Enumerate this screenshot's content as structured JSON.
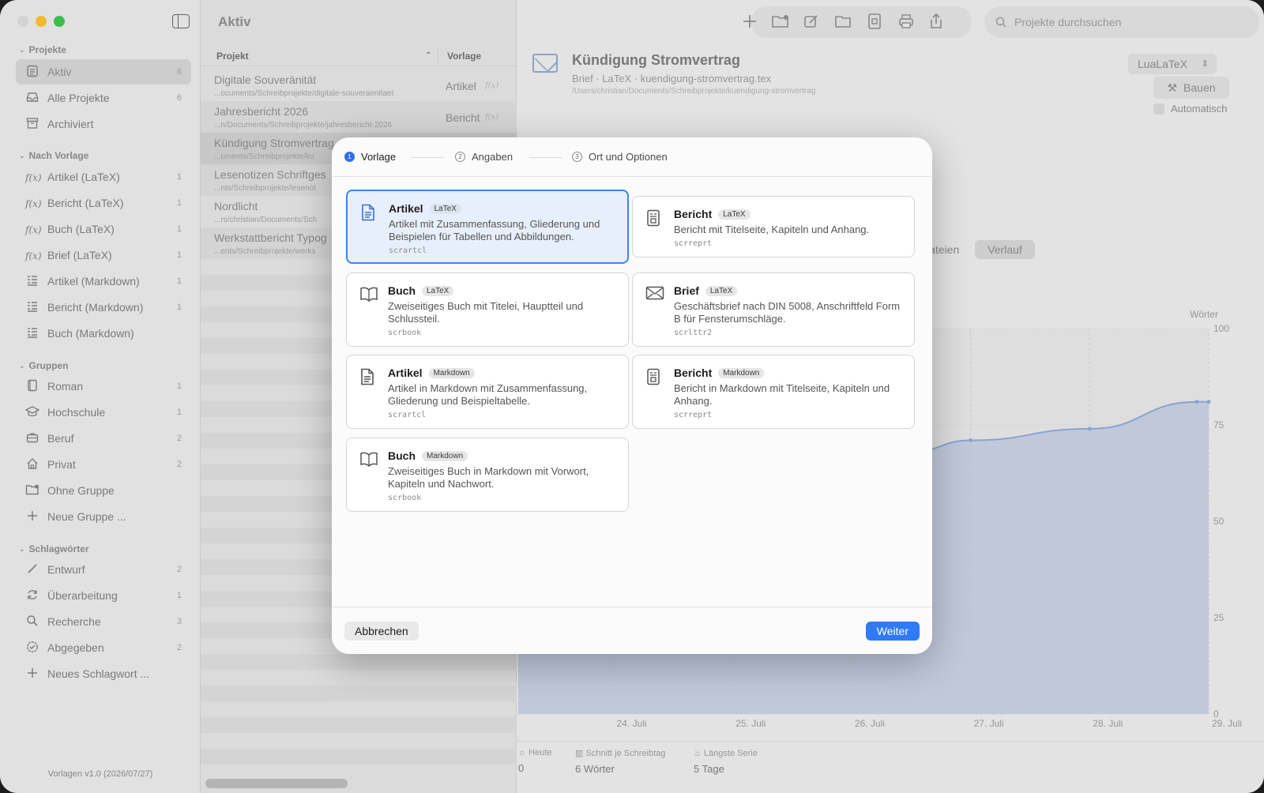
{
  "window": {
    "traffic_colors": [
      "#d8d8d8",
      "#f5be2f",
      "#3fc24e"
    ]
  },
  "sidebar": {
    "sections": [
      {
        "title": "Projekte",
        "items": [
          {
            "label": "Aktiv",
            "count": "6",
            "icon": "checklist-icon",
            "active": true
          },
          {
            "label": "Alle Projekte",
            "count": "6",
            "icon": "tray-icon"
          },
          {
            "label": "Archiviert",
            "count": "",
            "icon": "archive-box-icon"
          }
        ]
      },
      {
        "title": "Nach Vorlage",
        "items": [
          {
            "label": "Artikel (LaTeX)",
            "count": "1",
            "icon": "function-icon"
          },
          {
            "label": "Bericht (LaTeX)",
            "count": "1",
            "icon": "function-icon"
          },
          {
            "label": "Buch (LaTeX)",
            "count": "1",
            "icon": "function-icon"
          },
          {
            "label": "Brief (LaTeX)",
            "count": "1",
            "icon": "function-icon"
          },
          {
            "label": "Artikel (Markdown)",
            "count": "1",
            "icon": "markdown-list-icon"
          },
          {
            "label": "Bericht (Markdown)",
            "count": "1",
            "icon": "markdown-list-icon"
          },
          {
            "label": "Buch (Markdown)",
            "count": "",
            "icon": "markdown-list-icon"
          }
        ]
      },
      {
        "title": "Gruppen",
        "items": [
          {
            "label": "Roman",
            "count": "1",
            "icon": "book-icon"
          },
          {
            "label": "Hochschule",
            "count": "1",
            "icon": "graduation-cap-icon"
          },
          {
            "label": "Beruf",
            "count": "2",
            "icon": "briefcase-icon"
          },
          {
            "label": "Privat",
            "count": "2",
            "icon": "house-icon"
          },
          {
            "label": "Ohne Gruppe",
            "count": "",
            "icon": "folder-badge-icon"
          },
          {
            "label": "Neue Gruppe ...",
            "count": "",
            "icon": "plus-icon"
          }
        ]
      },
      {
        "title": "Schlagwörter",
        "items": [
          {
            "label": "Entwurf",
            "count": "2",
            "icon": "pencil-icon"
          },
          {
            "label": "Überarbeitung",
            "count": "1",
            "icon": "refresh-icon"
          },
          {
            "label": "Recherche",
            "count": "3",
            "icon": "magnifier-icon"
          },
          {
            "label": "Abgegeben",
            "count": "2",
            "icon": "checkmark-seal-icon"
          },
          {
            "label": "Neues Schlagwort ...",
            "count": "",
            "icon": "plus-icon"
          }
        ]
      }
    ],
    "footer": "Vorlagen v1.0 (2026/07/27)"
  },
  "list": {
    "title": "Aktiv",
    "col_project": "Projekt",
    "col_template": "Vorlage",
    "rows": [
      {
        "title": "Digitale Souveränität",
        "path": "...ocuments/Schreibprojekte/digitale-souveraenitaet",
        "template": "Artikel",
        "fx": "f(x)"
      },
      {
        "title": "Jahresbericht 2026",
        "path": "...n/Documents/Schreibprojekte/jahresbericht-2026",
        "template": "Bericht",
        "fx": "f(x)"
      },
      {
        "title": "Kündigung Stromvertrag",
        "path": "...uments/Schreibprojekte/ku",
        "template": "",
        "fx": ""
      },
      {
        "title": "Lesenotizen Schriftges",
        "path": "...nts/Schreibprojekte/lesenot",
        "template": "",
        "fx": ""
      },
      {
        "title": "Nordlicht",
        "path": "...rs/christian/Documents/Sch",
        "template": "",
        "fx": ""
      },
      {
        "title": "Werkstattbericht Typog",
        "path": "...ents/Schreibprojekte/werks",
        "template": "",
        "fx": ""
      }
    ]
  },
  "main": {
    "search_placeholder": "Projekte durchsuchen",
    "doc_title": "Kündigung Stromvertrag",
    "doc_meta": "Brief · LaTeX · kuendigung-stromvertrag.tex",
    "doc_path": "/Users/christian/Documents/Schreibprojekte/kuendigung-stromvertrag",
    "engine": "LuaLaTeX",
    "build_label": "Bauen",
    "auto_label": "Automatisch",
    "tabs": [
      {
        "label": "Dateien",
        "active": false
      },
      {
        "label": "Verlauf",
        "active": true
      }
    ],
    "stats": [
      {
        "label": "Heute",
        "value": "0",
        "icon": "sun-icon"
      },
      {
        "label": "Schnitt je Schreibtag",
        "value": "6 Wörter",
        "icon": "bar-chart-icon"
      },
      {
        "label": "Längste Serie",
        "value": "5 Tage",
        "icon": "flame-icon"
      }
    ]
  },
  "chart_data": {
    "type": "area",
    "ylabel": "Wörter",
    "ylim": [
      0,
      100
    ],
    "yticks": [
      "0",
      "25",
      "50",
      "75",
      "100"
    ],
    "xticks": [
      "24. Juli",
      "25. Juli",
      "26. Juli",
      "27. Juli",
      "28. Juli",
      "29. Juli"
    ],
    "points": [
      {
        "x": 26.5,
        "y": 68
      },
      {
        "x": 27,
        "y": 71
      },
      {
        "x": 28,
        "y": 74
      },
      {
        "x": 28.9,
        "y": 81
      },
      {
        "x": 29,
        "y": 81
      }
    ],
    "xlim": [
      23.2,
      29
    ],
    "color": "#8fa6d6"
  },
  "modal": {
    "steps": [
      {
        "num": "1",
        "label": "Vorlage",
        "active": true
      },
      {
        "num": "2",
        "label": "Angaben",
        "active": false
      },
      {
        "num": "3",
        "label": "Ort und Optionen",
        "active": false
      }
    ],
    "cards": [
      {
        "name": "Artikel",
        "badge": "LaTeX",
        "desc": "Artikel mit Zusammenfassung, Gliederung und Beispielen für Tabellen und Abbildungen.",
        "cls": "scrartcl",
        "icon": "document-icon",
        "selected": true
      },
      {
        "name": "Bericht",
        "badge": "LaTeX",
        "desc": "Bericht mit Titelseite, Kapiteln und Anhang.",
        "cls": "scrreprt",
        "icon": "report-icon",
        "selected": false
      },
      {
        "name": "Buch",
        "badge": "LaTeX",
        "desc": "Zweiseitiges Buch mit Titelei, Hauptteil und Schlussteil.",
        "cls": "scrbook",
        "icon": "open-book-icon",
        "selected": false
      },
      {
        "name": "Brief",
        "badge": "LaTeX",
        "desc": "Geschäftsbrief nach DIN 5008, Anschriftfeld Form B für Fensterumschläge.",
        "cls": "scrlttr2",
        "icon": "envelope-icon",
        "selected": false
      },
      {
        "name": "Artikel",
        "badge": "Markdown",
        "desc": "Artikel in Markdown mit Zusammenfassung, Gliederung und Beispieltabelle.",
        "cls": "scrartcl",
        "icon": "document-icon",
        "selected": false
      },
      {
        "name": "Bericht",
        "badge": "Markdown",
        "desc": "Bericht in Markdown mit Titelseite, Kapiteln und Anhang.",
        "cls": "scrreprt",
        "icon": "report-icon",
        "selected": false
      },
      {
        "name": "Buch",
        "badge": "Markdown",
        "desc": "Zweiseitiges Buch in Markdown mit Vorwort, Kapiteln und Nachwort.",
        "cls": "scrbook",
        "icon": "open-book-icon",
        "selected": false
      }
    ],
    "cancel_label": "Abbrechen",
    "next_label": "Weiter",
    "accent": "#2f7af6"
  }
}
